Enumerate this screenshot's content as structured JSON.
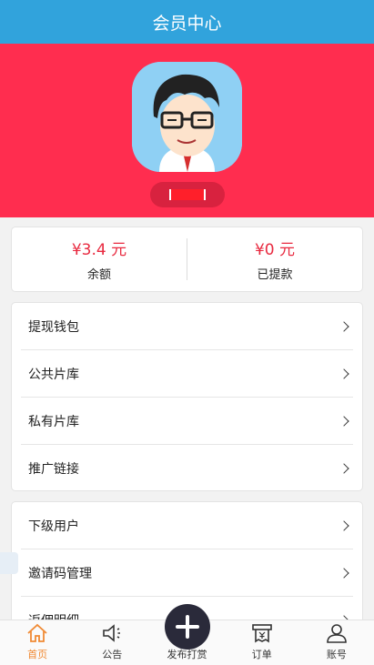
{
  "header": {
    "title": "会员中心"
  },
  "profile": {
    "username_redacted": ""
  },
  "balance": {
    "available": {
      "amount": "¥3.4 元",
      "label": "余额"
    },
    "withdrawn": {
      "amount": "¥0 元",
      "label": "已提款"
    }
  },
  "menu_primary": [
    {
      "label": "提现钱包"
    },
    {
      "label": "公共片库"
    },
    {
      "label": "私有片库"
    },
    {
      "label": "推广链接"
    }
  ],
  "menu_secondary": [
    {
      "label": "下级用户"
    },
    {
      "label": "邀请码管理"
    },
    {
      "label": "返佣明细"
    }
  ],
  "tabbar": [
    {
      "label": "首页",
      "icon": "home-icon"
    },
    {
      "label": "公告",
      "icon": "speaker-icon"
    },
    {
      "label": "发布打赏",
      "icon": "plus-icon"
    },
    {
      "label": "订单",
      "icon": "order-icon"
    },
    {
      "label": "账号",
      "icon": "user-icon"
    }
  ],
  "colors": {
    "header": "#31a3dc",
    "hero": "#ff2d4f",
    "amount": "#e8293f",
    "active_tab": "#f08a34"
  }
}
